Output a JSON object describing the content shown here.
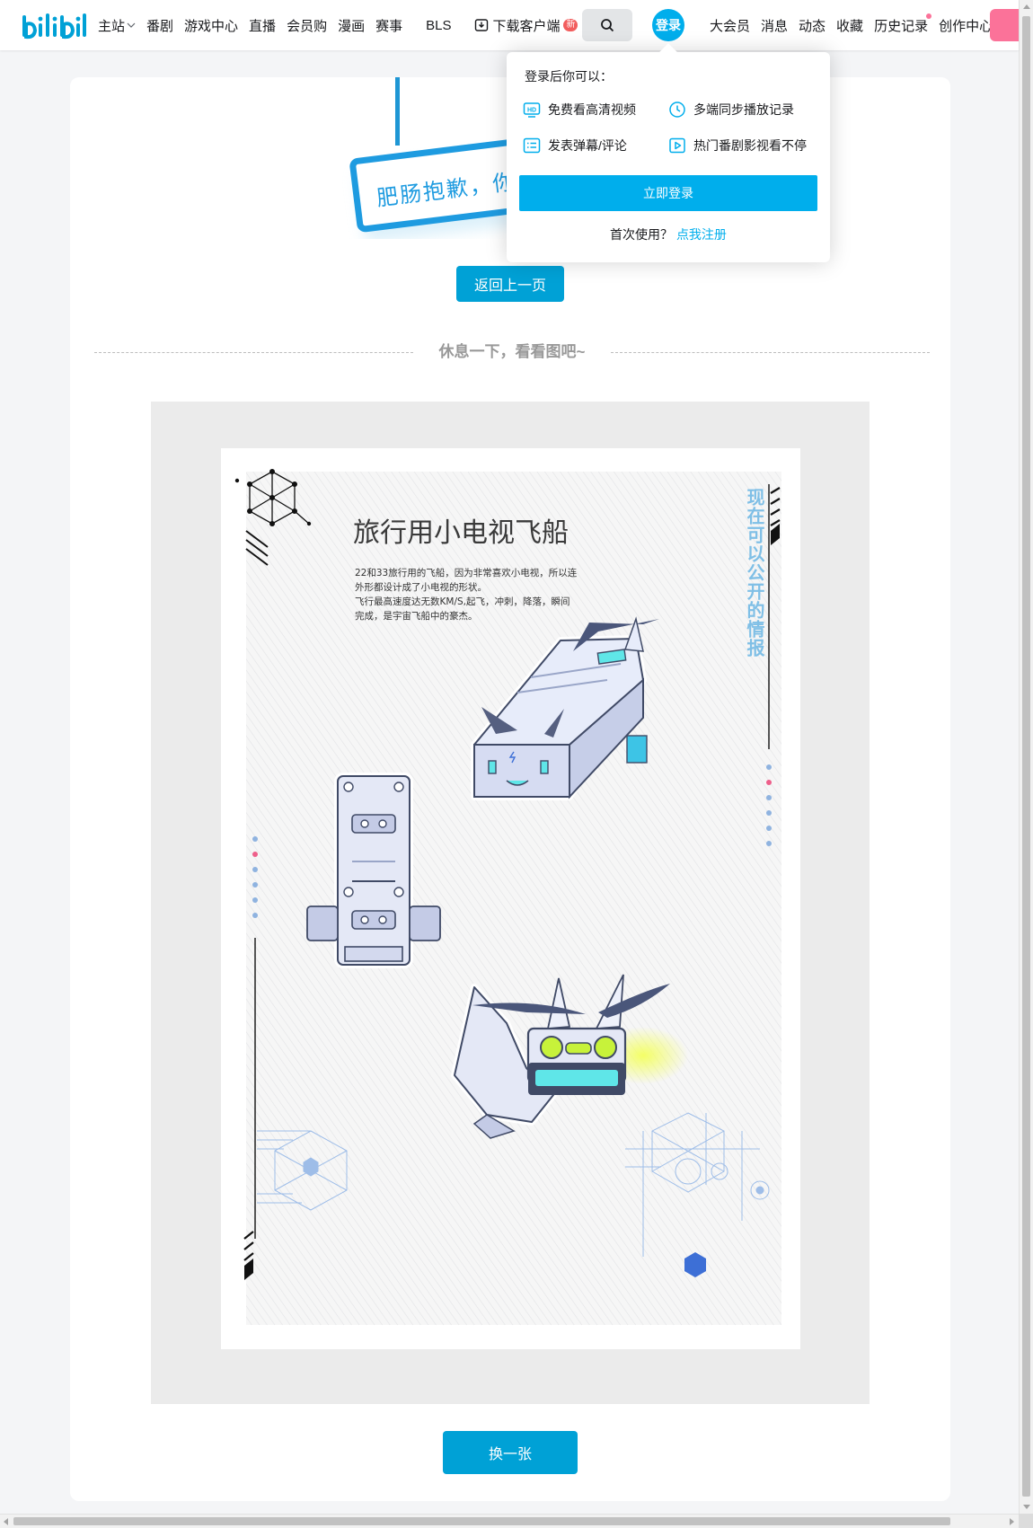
{
  "header": {
    "nav": [
      {
        "label": "主站",
        "icon": "chevron-down-icon"
      },
      {
        "label": "番剧"
      },
      {
        "label": "游戏中心"
      },
      {
        "label": "直播"
      },
      {
        "label": "会员购"
      },
      {
        "label": "漫画"
      },
      {
        "label": "赛事"
      },
      {
        "label": "BLS"
      }
    ],
    "download": {
      "label": "下载客户端",
      "badge": "新"
    },
    "login_avatar": "登录",
    "right_nav": [
      "大会员",
      "消息",
      "动态",
      "收藏",
      "历史记录",
      "创作中心"
    ],
    "accent": "#00aeec",
    "pink": "#fb7299"
  },
  "login_popover": {
    "title": "登录后你可以：",
    "perks": [
      {
        "label": "免费看高清视频",
        "icon": "hd-icon"
      },
      {
        "label": "多端同步播放记录",
        "icon": "clock-icon"
      },
      {
        "label": "发表弹幕/评论",
        "icon": "comment-list-icon"
      },
      {
        "label": "热门番剧影视看不停",
        "icon": "play-icon"
      }
    ],
    "button": "立即登录",
    "footer_text": "首次使用？",
    "footer_link": "点我注册"
  },
  "error_page": {
    "sign_text": "肥肠抱歉，你要",
    "back_button": "返回上一页",
    "divider_text": "休息一下，看看图吧~",
    "swap_button": "换一张",
    "button_color": "#00a1d6"
  },
  "poster": {
    "title": "旅行用小电视飞船",
    "description": [
      "22和33旅行用的飞船，因为非常喜欢小电视，所以连",
      "外形都设计成了小电视的形状。",
      "飞行最高速度达无数KM/S,起飞，冲刺，降落，瞬间",
      "完成，是宇宙飞船中的豪杰。"
    ],
    "vertical_text": "现在可以公开的情报"
  }
}
